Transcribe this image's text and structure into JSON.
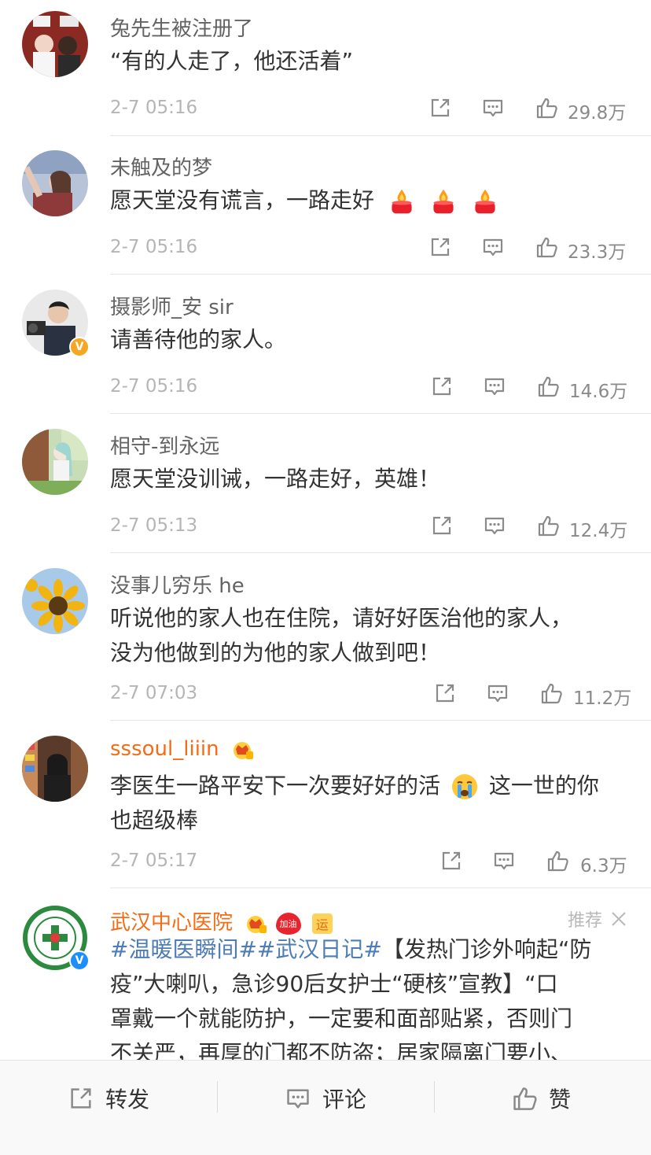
{
  "comments": [
    {
      "name": "兔先生被注册了",
      "text": "“有的人走了，他还活着”",
      "time": "2-7 05:16",
      "likes": "29.8万"
    },
    {
      "name": "未触及的梦",
      "text": "愿天堂没有谎言，一路走好",
      "time": "2-7 05:16",
      "likes": "23.3万"
    },
    {
      "name": "摄影师_安 sir",
      "text": "请善待他的家人。",
      "time": "2-7 05:16",
      "likes": "14.6万"
    },
    {
      "name": "相守-到永远",
      "text": "愿天堂没训诫，一路走好，英雄！",
      "time": "2-7 05:13",
      "likes": "12.4万"
    },
    {
      "name": "没事儿穷乐 he",
      "text_line1": "听说他的家人也在住院，请好好医治他的家人，",
      "text_line2": "没为他做到的为他的家人做到吧！",
      "time": "2-7 07:03",
      "likes": "11.2万"
    },
    {
      "name": "sssoul_liiin",
      "text_line1a": "李医生一路平安下一次要好好的活",
      "text_line1b": "这一世的你",
      "text_line2": "也超级棒",
      "time": "2-7 05:17",
      "likes": "6.3万"
    }
  ],
  "post": {
    "name": "武汉中心医院",
    "recommend": "推荐",
    "badge_text": "加油",
    "badge2_text": "运",
    "topic": "#温暖医瞬间##武汉日记#",
    "line1_rest": "【发热门诊外响起“防",
    "line2": "疫”大喇叭，急诊90后女护士“硬核”宣教】“口",
    "line3": "罩戴一个就能防护，一定要和面部贴紧，否则门",
    "line4": "不关严，再厚的门都不防盗；居家隔离门要小、"
  },
  "bottom_bar": {
    "repost": "转发",
    "comment": "评论",
    "like": "赞"
  },
  "colors": {
    "orange_name": "#f46c16",
    "topic_blue": "#4d7cb7",
    "verified_gold": "#f5a623",
    "verified_blue": "#1e8ffa"
  }
}
